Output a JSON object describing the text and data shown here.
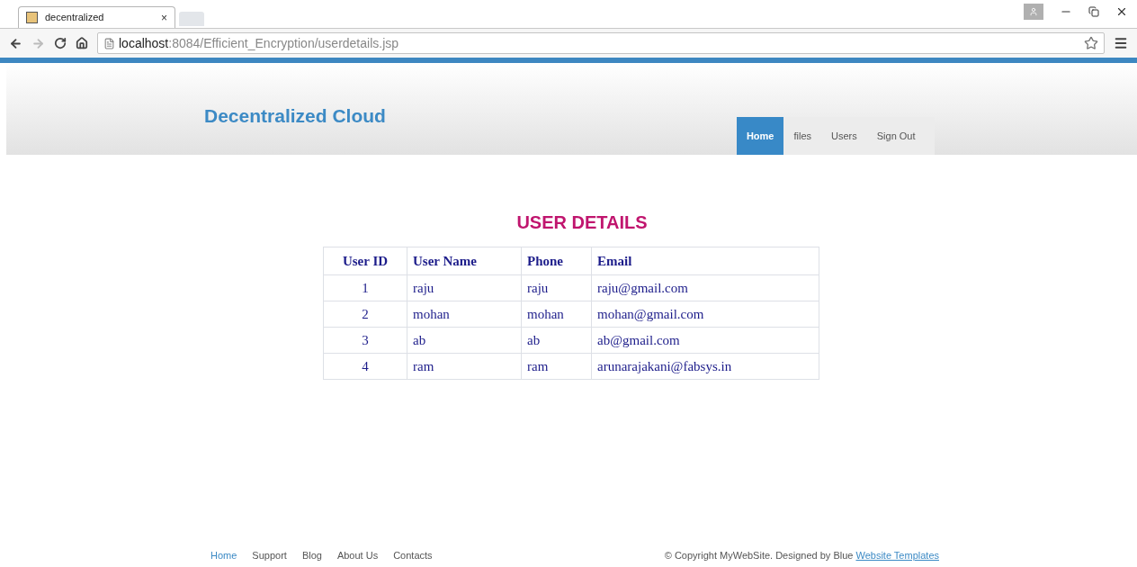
{
  "browser": {
    "tab_title": "decentralized",
    "tab_close": "×",
    "url_host": "localhost",
    "url_path": ":8084/Efficient_Encryption/userdetails.jsp"
  },
  "header": {
    "title": "Decentralized Cloud",
    "nav": [
      {
        "label": "Home",
        "selected": true
      },
      {
        "label": "files",
        "selected": false
      },
      {
        "label": "Users",
        "selected": false
      },
      {
        "label": "Sign Out",
        "selected": false
      }
    ]
  },
  "heading": "USER DETAILS",
  "table": {
    "columns": [
      "User ID",
      "User Name",
      "Phone",
      "Email"
    ],
    "rows": [
      [
        "1",
        "raju",
        "raju",
        "raju@gmail.com"
      ],
      [
        "2",
        "mohan",
        "mohan",
        "mohan@gmail.com"
      ],
      [
        "3",
        "ab",
        "ab",
        "ab@gmail.com"
      ],
      [
        "4",
        "ram",
        "ram",
        "arunarajakani@fabsys.in"
      ]
    ]
  },
  "footer": {
    "links": [
      {
        "label": "Home",
        "selected": true
      },
      {
        "label": "Support",
        "selected": false
      },
      {
        "label": "Blog",
        "selected": false
      },
      {
        "label": "About Us",
        "selected": false
      },
      {
        "label": "Contacts",
        "selected": false
      }
    ],
    "copyright": "© Copyright MyWebSite. Designed by Blue",
    "copyright_link": "Website Templates"
  }
}
